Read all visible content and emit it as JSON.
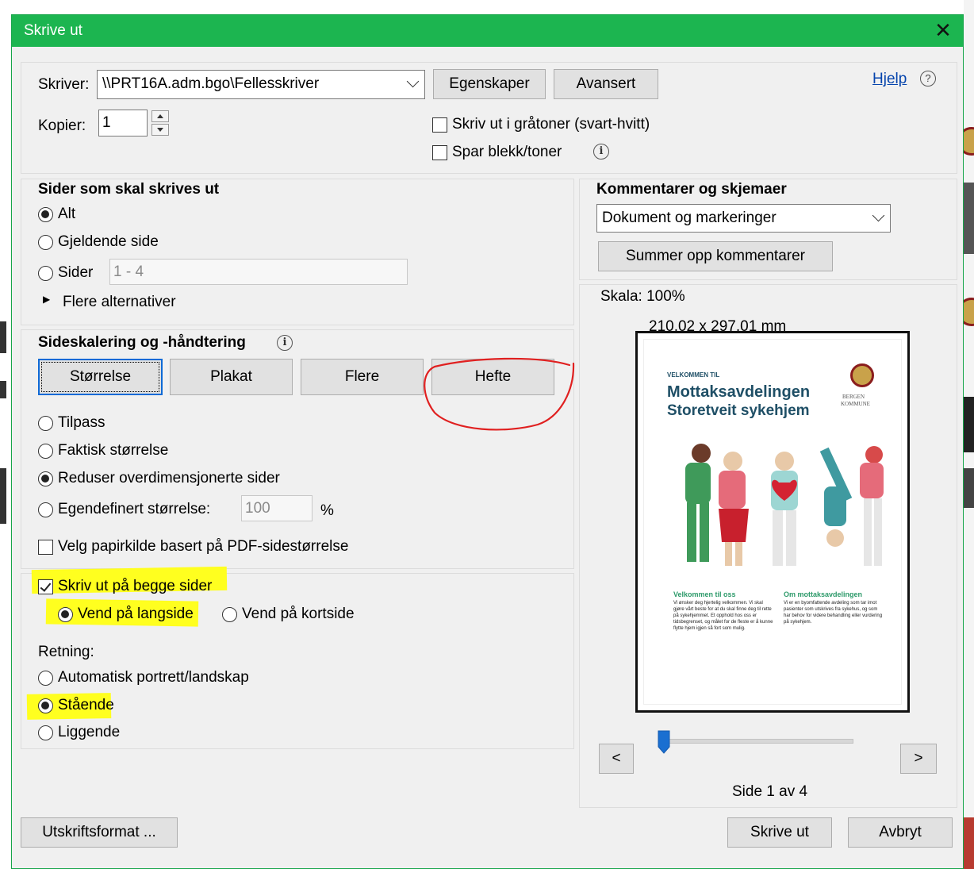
{
  "window": {
    "title": "Skrive ut",
    "close_glyph": "✕"
  },
  "printer": {
    "label": "Skriver:",
    "value": "\\\\PRT16A.adm.bgo\\Fellesskriver",
    "properties_label": "Egenskaper",
    "advanced_label": "Avansert",
    "help_link": "Hjelp",
    "copies_label": "Kopier:",
    "copies_value": "1",
    "grayscale_label": "Skriv ut i gråtoner (svart-hvitt)",
    "grayscale_checked": false,
    "save_ink_label": "Spar blekk/toner",
    "save_ink_checked": false
  },
  "pages": {
    "heading": "Sider som skal skrives ut",
    "options": [
      {
        "label": "Alt",
        "selected": true
      },
      {
        "label": "Gjeldende side",
        "selected": false
      },
      {
        "label": "Sider",
        "selected": false
      }
    ],
    "range_value": "1 - 4",
    "more_options": "Flere alternativer"
  },
  "scaling": {
    "heading": "Sideskalering og -håndtering",
    "tabs": [
      "Størrelse",
      "Plakat",
      "Flere",
      "Hefte"
    ],
    "options": [
      {
        "label": "Tilpass",
        "selected": false
      },
      {
        "label": "Faktisk størrelse",
        "selected": false
      },
      {
        "label": "Reduser overdimensjonerte sider",
        "selected": true
      },
      {
        "label": "Egendefinert størrelse:",
        "selected": false
      }
    ],
    "custom_value": "100",
    "percent": "%",
    "paper_source_label": "Velg papirkilde basert på PDF-sidestørrelse",
    "paper_source_checked": false
  },
  "duplex": {
    "label": "Skriv ut på begge sider",
    "checked": true,
    "long_edge": "Vend på langside",
    "short_edge": "Vend på kortside",
    "orientation_label": "Retning:",
    "orientation_options": [
      {
        "label": "Automatisk portrett/landskap",
        "selected": false
      },
      {
        "label": "Stående",
        "selected": true
      },
      {
        "label": "Liggende",
        "selected": false
      }
    ]
  },
  "comments": {
    "heading": "Kommentarer og skjemaer",
    "value": "Dokument og markeringer",
    "summarize_label": "Summer opp kommentarer"
  },
  "preview": {
    "scale": "Skala: 100%",
    "size": "210,02 x 297,01 mm",
    "prev": "<",
    "next": ">",
    "page_status": "Side 1 av 4",
    "page_current": 1,
    "page_total": 4,
    "doc": {
      "kicker": "VELKOMMEN TIL",
      "title_line1": "Mottaksavdelingen",
      "title_line2": "Storetveit sykehjem",
      "logo_line1": "BERGEN",
      "logo_line2": "KOMMUNE",
      "col1_heading": "Velkommen til oss",
      "col1_text": "Vi ønsker deg hjertelig velkommen. Vi skal gjøre vårt beste for at du skal finne deg til rette på sykehjemmet. Et opphold hos oss er tidsbegrenset, og målet for de fleste er å kunne flytte hjem igjen så fort som mulig.",
      "col2_heading": "Om mottaksavdelingen",
      "col2_text": "Vi er en byomfattende avdeling som tar imot pasienter som utskrives fra sykehus, og som har behov for videre behandling eller vurdering på sykehjem."
    }
  },
  "footer": {
    "page_setup": "Utskriftsformat ...",
    "print": "Skrive ut",
    "cancel": "Avbryt"
  },
  "colors": {
    "titlebar": "#1cb550",
    "highlight": "#ffff1f",
    "annotation": "#e02020",
    "link": "#0645ad",
    "slider": "#1a6fd1"
  }
}
